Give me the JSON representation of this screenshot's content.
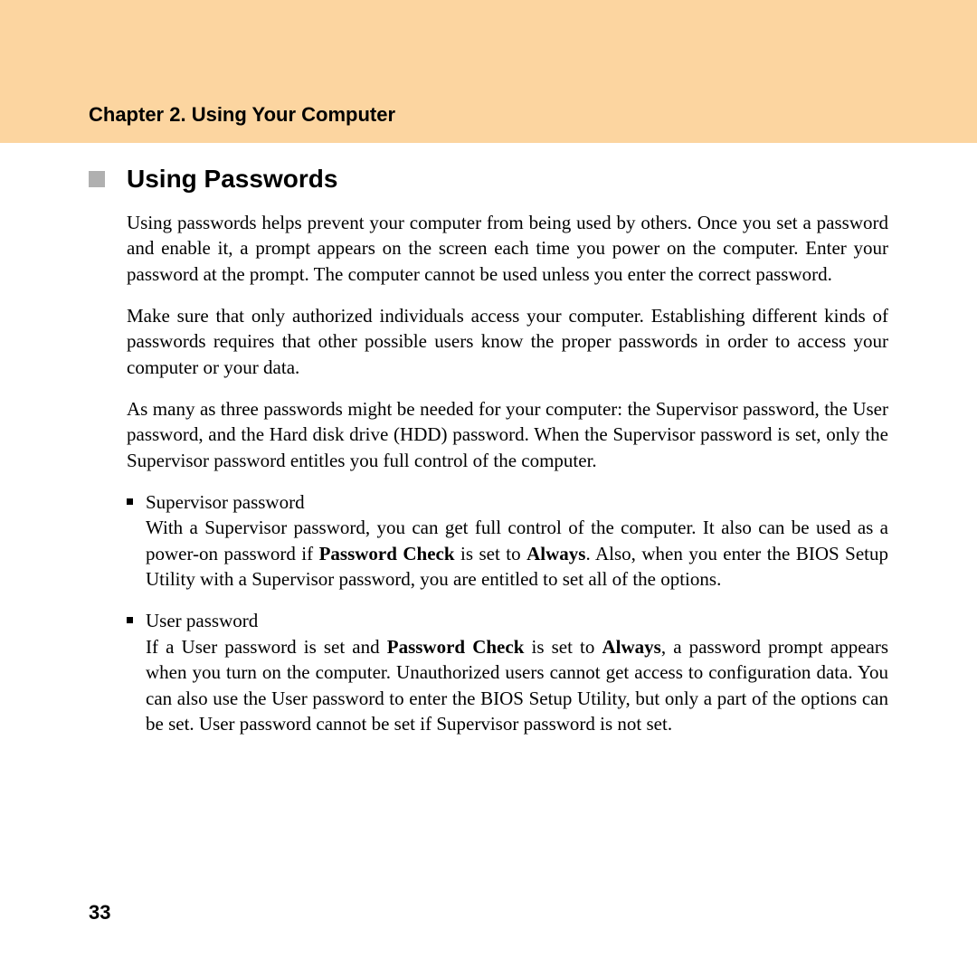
{
  "header": {
    "chapter_title": "Chapter 2. Using Your Computer"
  },
  "section": {
    "heading": "Using Passwords",
    "para1": "Using passwords helps prevent your computer from being used by others. Once you set a password and enable it, a prompt appears on the screen each time you power on the computer. Enter your password at the prompt. The computer cannot be used unless you enter the correct password.",
    "para2": "Make sure that only authorized individuals access your computer. Establishing different kinds of passwords requires that other possible users know the proper passwords in order to access your computer or your data.",
    "para3": "As many as three passwords might be needed for your computer: the Supervisor password, the User password,  and the Hard disk drive (HDD) password. When the Supervisor password is set, only the Supervisor password entitles you full control of the computer.",
    "bullets": [
      {
        "title": "Supervisor password",
        "body_pre": "With a Supervisor password, you can get full control of the computer. It also can be used as a power-on password if ",
        "bold1": "Password Check",
        "mid1": " is set to ",
        "bold2": "Always",
        "body_post": ". Also, when you enter the BIOS Setup Utility with a Supervisor password, you are entitled to set all of the options."
      },
      {
        "title": "User password",
        "body_pre": "If a User password is set and ",
        "bold1": "Password Check",
        "mid1": " is set to ",
        "bold2": "Always",
        "body_post": ", a password prompt appears when you turn on the computer. Unauthorized users cannot get access to configuration data. You can also use the User password to enter the BIOS Setup Utility, but only a part of the options can be set. User password cannot be set if Supervisor password is not set."
      }
    ]
  },
  "page_number": "33"
}
